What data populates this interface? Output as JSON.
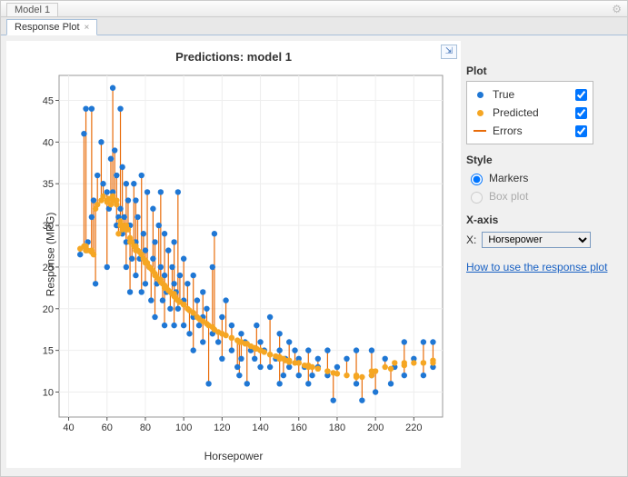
{
  "window": {
    "title": "Model 1"
  },
  "tabs": {
    "active": "Response Plot"
  },
  "chart_data": {
    "type": "scatter",
    "title": "Predictions: model 1",
    "xlabel": "Horsepower",
    "ylabel": "Response (MPG)",
    "xlim": [
      35,
      235
    ],
    "ylim": [
      7,
      48
    ],
    "xticks": [
      40,
      60,
      80,
      100,
      120,
      140,
      160,
      180,
      200,
      220
    ],
    "yticks": [
      10,
      15,
      20,
      25,
      30,
      35,
      40,
      45
    ],
    "series": [
      {
        "name": "True",
        "style": "marker",
        "color": "#1f77d4"
      },
      {
        "name": "Predicted",
        "style": "marker",
        "color": "#f5a623"
      },
      {
        "name": "Errors",
        "style": "line",
        "color": "#e86c0a"
      }
    ],
    "points": [
      {
        "x": 46,
        "true": 26.5,
        "pred": 27.2
      },
      {
        "x": 48,
        "true": 41,
        "pred": 27.5
      },
      {
        "x": 49,
        "true": 44,
        "pred": 27
      },
      {
        "x": 49,
        "true": 27,
        "pred": 27.5
      },
      {
        "x": 50,
        "true": 28,
        "pred": 27
      },
      {
        "x": 52,
        "true": 31,
        "pred": 27
      },
      {
        "x": 52,
        "true": 44,
        "pred": 26.8
      },
      {
        "x": 53,
        "true": 33,
        "pred": 26.5
      },
      {
        "x": 54,
        "true": 23,
        "pred": 32
      },
      {
        "x": 55,
        "true": 36,
        "pred": 32.5
      },
      {
        "x": 57,
        "true": 40,
        "pred": 33
      },
      {
        "x": 58,
        "true": 35,
        "pred": 33.5
      },
      {
        "x": 60,
        "true": 34,
        "pred": 33
      },
      {
        "x": 60,
        "true": 25,
        "pred": 32.8
      },
      {
        "x": 61,
        "true": 32,
        "pred": 33.2
      },
      {
        "x": 62,
        "true": 38,
        "pred": 32.5
      },
      {
        "x": 63,
        "true": 46.5,
        "pred": 33
      },
      {
        "x": 63,
        "true": 34,
        "pred": 33.5
      },
      {
        "x": 64,
        "true": 39,
        "pred": 33
      },
      {
        "x": 65,
        "true": 30,
        "pred": 32.5
      },
      {
        "x": 65,
        "true": 36,
        "pred": 33
      },
      {
        "x": 66,
        "true": 31,
        "pred": 29
      },
      {
        "x": 67,
        "true": 44,
        "pred": 30
      },
      {
        "x": 67,
        "true": 32,
        "pred": 30.5
      },
      {
        "x": 68,
        "true": 29,
        "pred": 29.5
      },
      {
        "x": 68,
        "true": 37,
        "pred": 30
      },
      {
        "x": 69,
        "true": 31,
        "pred": 29.8
      },
      {
        "x": 70,
        "true": 28,
        "pred": 29.5
      },
      {
        "x": 70,
        "true": 35,
        "pred": 30
      },
      {
        "x": 70,
        "true": 25,
        "pred": 29.8
      },
      {
        "x": 71,
        "true": 33,
        "pred": 29.5
      },
      {
        "x": 72,
        "true": 22,
        "pred": 28
      },
      {
        "x": 72,
        "true": 30,
        "pred": 28.5
      },
      {
        "x": 73,
        "true": 26,
        "pred": 28
      },
      {
        "x": 74,
        "true": 35,
        "pred": 27.5
      },
      {
        "x": 75,
        "true": 24,
        "pred": 27
      },
      {
        "x": 75,
        "true": 33,
        "pred": 27.5
      },
      {
        "x": 75,
        "true": 28,
        "pred": 27.3
      },
      {
        "x": 76,
        "true": 31,
        "pred": 27
      },
      {
        "x": 77,
        "true": 26,
        "pred": 26.8
      },
      {
        "x": 78,
        "true": 36,
        "pred": 26.5
      },
      {
        "x": 78,
        "true": 22,
        "pred": 26.5
      },
      {
        "x": 79,
        "true": 29,
        "pred": 26
      },
      {
        "x": 80,
        "true": 27,
        "pred": 25.8
      },
      {
        "x": 80,
        "true": 23,
        "pred": 25.5
      },
      {
        "x": 81,
        "true": 34,
        "pred": 25.5
      },
      {
        "x": 82,
        "true": 25,
        "pred": 25
      },
      {
        "x": 83,
        "true": 21,
        "pred": 24.8
      },
      {
        "x": 84,
        "true": 32,
        "pred": 24.5
      },
      {
        "x": 84,
        "true": 26,
        "pred": 24.5
      },
      {
        "x": 85,
        "true": 28,
        "pred": 24
      },
      {
        "x": 85,
        "true": 19,
        "pred": 24.2
      },
      {
        "x": 86,
        "true": 23,
        "pred": 23.8
      },
      {
        "x": 87,
        "true": 30,
        "pred": 23.5
      },
      {
        "x": 88,
        "true": 25,
        "pred": 23.2
      },
      {
        "x": 88,
        "true": 34,
        "pred": 23.5
      },
      {
        "x": 89,
        "true": 21,
        "pred": 23
      },
      {
        "x": 90,
        "true": 29,
        "pred": 22.8
      },
      {
        "x": 90,
        "true": 18,
        "pred": 22.5
      },
      {
        "x": 90,
        "true": 24,
        "pred": 22.8
      },
      {
        "x": 91,
        "true": 22,
        "pred": 22.5
      },
      {
        "x": 92,
        "true": 27,
        "pred": 22.2
      },
      {
        "x": 93,
        "true": 20,
        "pred": 22
      },
      {
        "x": 94,
        "true": 25,
        "pred": 21.8
      },
      {
        "x": 95,
        "true": 23,
        "pred": 21.5
      },
      {
        "x": 95,
        "true": 18,
        "pred": 21.5
      },
      {
        "x": 95,
        "true": 28,
        "pred": 21.8
      },
      {
        "x": 96,
        "true": 22,
        "pred": 21.2
      },
      {
        "x": 97,
        "true": 34,
        "pred": 21
      },
      {
        "x": 97,
        "true": 20,
        "pred": 21
      },
      {
        "x": 98,
        "true": 24,
        "pred": 20.8
      },
      {
        "x": 100,
        "true": 18,
        "pred": 20.5
      },
      {
        "x": 100,
        "true": 26,
        "pred": 20.5
      },
      {
        "x": 100,
        "true": 21,
        "pred": 20.5
      },
      {
        "x": 102,
        "true": 23,
        "pred": 20
      },
      {
        "x": 103,
        "true": 17,
        "pred": 19.8
      },
      {
        "x": 105,
        "true": 19,
        "pred": 19.5
      },
      {
        "x": 105,
        "true": 24,
        "pred": 19.5
      },
      {
        "x": 105,
        "true": 15,
        "pred": 19.5
      },
      {
        "x": 107,
        "true": 21,
        "pred": 19
      },
      {
        "x": 108,
        "true": 18,
        "pred": 18.8
      },
      {
        "x": 110,
        "true": 16,
        "pred": 18.5
      },
      {
        "x": 110,
        "true": 22,
        "pred": 18.5
      },
      {
        "x": 110,
        "true": 19,
        "pred": 18.5
      },
      {
        "x": 112,
        "true": 20,
        "pred": 18.2
      },
      {
        "x": 113,
        "true": 11,
        "pred": 18
      },
      {
        "x": 115,
        "true": 25,
        "pred": 17.8
      },
      {
        "x": 115,
        "true": 17,
        "pred": 17.8
      },
      {
        "x": 116,
        "true": 29,
        "pred": 17.5
      },
      {
        "x": 118,
        "true": 16,
        "pred": 17.2
      },
      {
        "x": 120,
        "true": 19,
        "pred": 17
      },
      {
        "x": 120,
        "true": 14,
        "pred": 17
      },
      {
        "x": 122,
        "true": 21,
        "pred": 16.8
      },
      {
        "x": 125,
        "true": 15,
        "pred": 16.5
      },
      {
        "x": 125,
        "true": 18,
        "pred": 16.5
      },
      {
        "x": 128,
        "true": 13,
        "pred": 16.2
      },
      {
        "x": 129,
        "true": 12,
        "pred": 16
      },
      {
        "x": 130,
        "true": 17,
        "pred": 16
      },
      {
        "x": 130,
        "true": 14,
        "pred": 16
      },
      {
        "x": 132,
        "true": 16,
        "pred": 15.8
      },
      {
        "x": 133,
        "true": 11,
        "pred": 15.8
      },
      {
        "x": 135,
        "true": 15,
        "pred": 15.5
      },
      {
        "x": 137,
        "true": 14,
        "pred": 15.3
      },
      {
        "x": 138,
        "true": 18,
        "pred": 15.2
      },
      {
        "x": 140,
        "true": 13,
        "pred": 15
      },
      {
        "x": 140,
        "true": 16,
        "pred": 15
      },
      {
        "x": 142,
        "true": 15,
        "pred": 14.8
      },
      {
        "x": 145,
        "true": 13,
        "pred": 14.5
      },
      {
        "x": 145,
        "true": 19,
        "pred": 14.5
      },
      {
        "x": 148,
        "true": 14,
        "pred": 14.3
      },
      {
        "x": 150,
        "true": 15,
        "pred": 14
      },
      {
        "x": 150,
        "true": 11,
        "pred": 14
      },
      {
        "x": 150,
        "true": 17,
        "pred": 14.2
      },
      {
        "x": 152,
        "true": 12,
        "pred": 14
      },
      {
        "x": 153,
        "true": 14,
        "pred": 13.8
      },
      {
        "x": 155,
        "true": 16,
        "pred": 13.8
      },
      {
        "x": 155,
        "true": 13,
        "pred": 13.6
      },
      {
        "x": 158,
        "true": 15,
        "pred": 13.5
      },
      {
        "x": 160,
        "true": 12,
        "pred": 13.5
      },
      {
        "x": 160,
        "true": 14,
        "pred": 13.5
      },
      {
        "x": 163,
        "true": 13,
        "pred": 13.2
      },
      {
        "x": 165,
        "true": 15,
        "pred": 13
      },
      {
        "x": 165,
        "true": 11,
        "pred": 13.2
      },
      {
        "x": 167,
        "true": 12,
        "pred": 13
      },
      {
        "x": 170,
        "true": 14,
        "pred": 12.8
      },
      {
        "x": 170,
        "true": 13,
        "pred": 12.8
      },
      {
        "x": 175,
        "true": 15,
        "pred": 12.5
      },
      {
        "x": 175,
        "true": 12,
        "pred": 12.5
      },
      {
        "x": 178,
        "true": 9,
        "pred": 12.3
      },
      {
        "x": 180,
        "true": 13,
        "pred": 12.2
      },
      {
        "x": 185,
        "true": 14,
        "pred": 12
      },
      {
        "x": 190,
        "true": 11,
        "pred": 12
      },
      {
        "x": 190,
        "true": 15,
        "pred": 11.8
      },
      {
        "x": 193,
        "true": 9,
        "pred": 11.8
      },
      {
        "x": 198,
        "true": 12,
        "pred": 12.5
      },
      {
        "x": 198,
        "true": 15,
        "pred": 12
      },
      {
        "x": 200,
        "true": 10,
        "pred": 12.5
      },
      {
        "x": 205,
        "true": 14,
        "pred": 13
      },
      {
        "x": 208,
        "true": 11,
        "pred": 12.8
      },
      {
        "x": 210,
        "true": 13,
        "pred": 13.5
      },
      {
        "x": 215,
        "true": 12,
        "pred": 13.2
      },
      {
        "x": 215,
        "true": 16,
        "pred": 13.5
      },
      {
        "x": 220,
        "true": 14,
        "pred": 13.5
      },
      {
        "x": 225,
        "true": 12,
        "pred": 13.5
      },
      {
        "x": 225,
        "true": 16,
        "pred": 13.5
      },
      {
        "x": 230,
        "true": 13,
        "pred": 13.5
      },
      {
        "x": 230,
        "true": 16,
        "pred": 13.8
      }
    ]
  },
  "side": {
    "plot_heading": "Plot",
    "legend": {
      "true": "True",
      "predicted": "Predicted",
      "errors": "Errors",
      "true_checked": true,
      "predicted_checked": true,
      "errors_checked": true
    },
    "style_heading": "Style",
    "style": {
      "markers": "Markers",
      "boxplot": "Box plot",
      "selected": "markers"
    },
    "xaxis_heading": "X-axis",
    "xaxis": {
      "label": "X:",
      "selected": "Horsepower",
      "options": [
        "Horsepower"
      ]
    },
    "help_link": "How to use the response plot"
  }
}
